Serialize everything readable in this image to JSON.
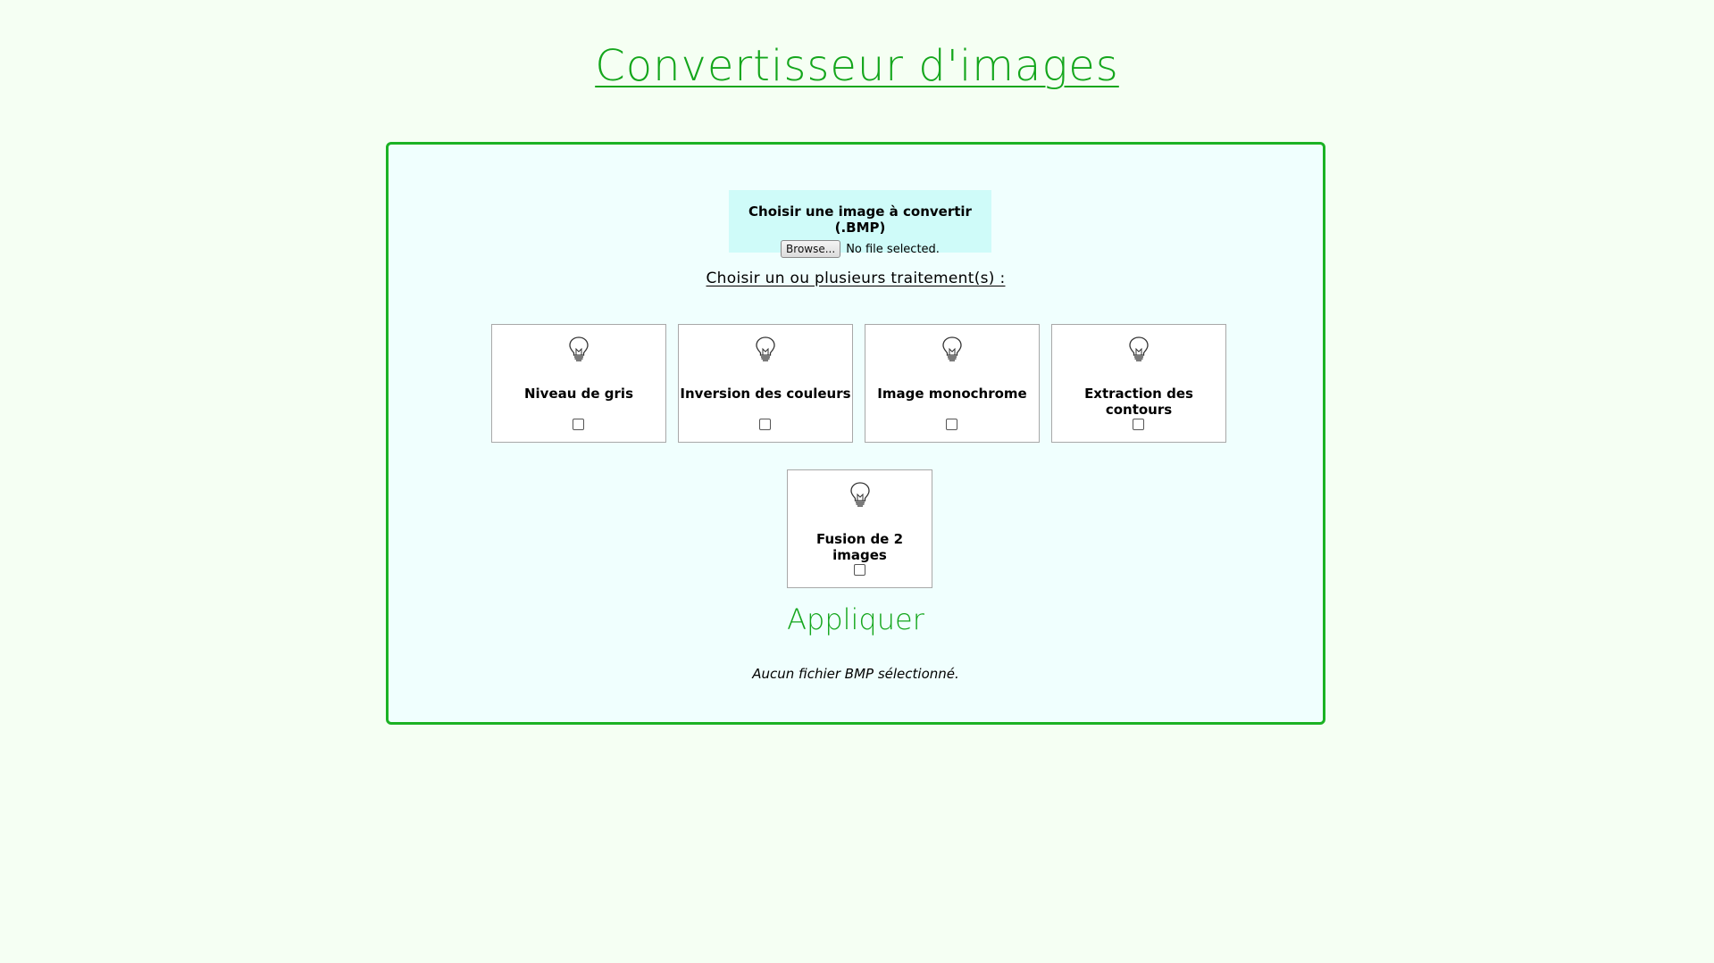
{
  "header": {
    "title": "Convertisseur d'images"
  },
  "upload": {
    "label": "Choisir une image à convertir (.BMP)",
    "browse_label": "Browse...",
    "file_status": "No file selected."
  },
  "treatments": {
    "heading": "Choisir un ou plusieurs traitement(s) :",
    "items": [
      {
        "label": "Niveau de gris",
        "icon": "lightbulb-icon",
        "checked": false
      },
      {
        "label": "Inversion des couleurs",
        "icon": "lightbulb-icon",
        "checked": false
      },
      {
        "label": "Image monochrome",
        "icon": "lightbulb-icon",
        "checked": false
      },
      {
        "label": "Extraction des contours",
        "icon": "lightbulb-icon",
        "checked": false
      },
      {
        "label": "Fusion de 2 images",
        "icon": "lightbulb-icon",
        "checked": false
      }
    ]
  },
  "actions": {
    "apply_label": "Appliquer"
  },
  "status": {
    "message": "Aucun fichier BMP sélectionné."
  },
  "colors": {
    "accent": "#14a61c",
    "panel_border": "#1cb224",
    "page_background": "#f5fff3",
    "panel_background": "#f0fffe",
    "upload_background": "#cffbf9"
  }
}
